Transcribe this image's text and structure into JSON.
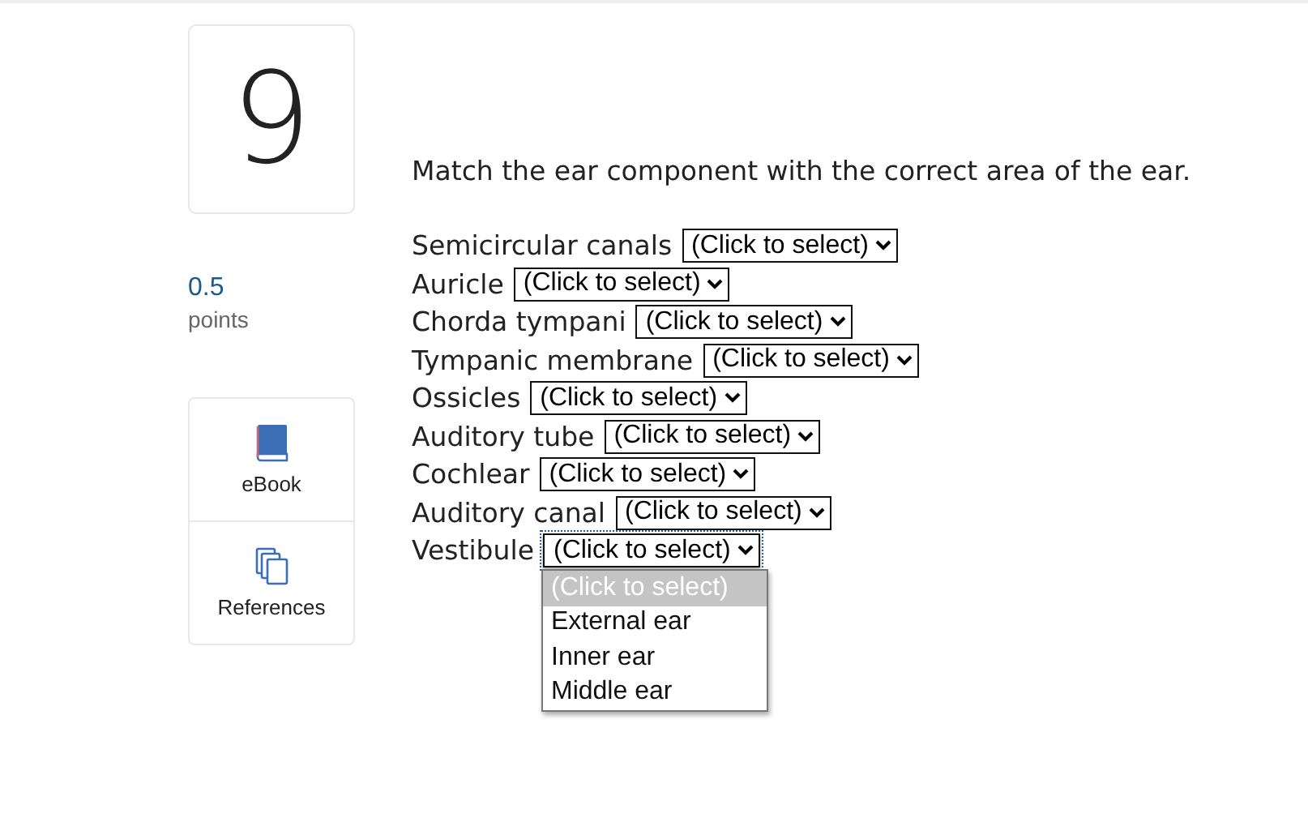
{
  "question_number": "9",
  "points": {
    "value": "0.5",
    "label": "points"
  },
  "tools": [
    {
      "kind": "book",
      "label": "eBook"
    },
    {
      "kind": "pages",
      "label": "References"
    }
  ],
  "prompt": "Match the ear component with the correct area of the ear.",
  "items": [
    {
      "term": "Semicircular canals",
      "value": "(Click to select)",
      "expanded": false
    },
    {
      "term": "Auricle",
      "value": "(Click to select)",
      "expanded": false
    },
    {
      "term": "Chorda tympani",
      "value": "(Click to select)",
      "expanded": false
    },
    {
      "term": "Tympanic membrane",
      "value": "(Click to select)",
      "expanded": false
    },
    {
      "term": "Ossicles",
      "value": "(Click to select)",
      "expanded": false
    },
    {
      "term": "Auditory tube",
      "value": "(Click to select)",
      "expanded": false
    },
    {
      "term": "Cochlear",
      "value": "(Click to select)",
      "expanded": false
    },
    {
      "term": "Auditory canal",
      "value": "(Click to select)",
      "expanded": false
    },
    {
      "term": "Vestibule",
      "value": "(Click to select)",
      "expanded": true
    }
  ],
  "options": [
    {
      "label": "(Click to select)",
      "selected": true
    },
    {
      "label": "External ear",
      "selected": false
    },
    {
      "label": "Inner ear",
      "selected": false
    },
    {
      "label": "Middle ear",
      "selected": false
    }
  ]
}
